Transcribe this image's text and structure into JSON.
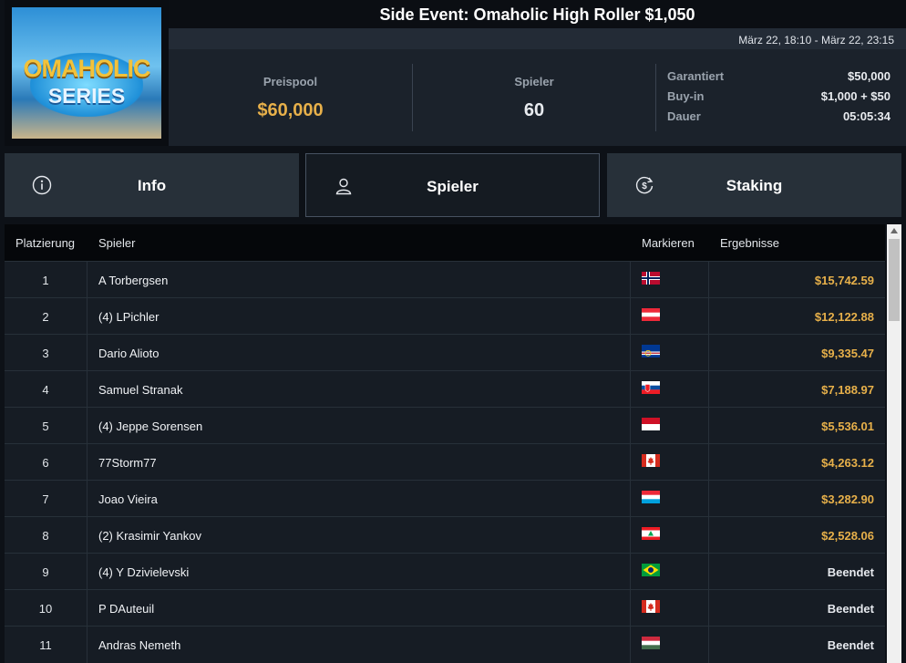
{
  "logo": {
    "line1": "OMAHOLIC",
    "line2": "SERIES"
  },
  "header": {
    "title": "Side Event: Omaholic High Roller $1,050",
    "dates": "März 22, 18:10 - März 22, 23:15"
  },
  "stats": {
    "prizepool_label": "Preispool",
    "prizepool_value": "$60,000",
    "players_label": "Spieler",
    "players_value": "60",
    "details": [
      {
        "key": "Garantiert",
        "value": "$50,000"
      },
      {
        "key": "Buy-in",
        "value": "$1,000 + $50"
      },
      {
        "key": "Dauer",
        "value": "05:05:34"
      }
    ]
  },
  "tabs": [
    {
      "label": "Info",
      "icon": "info-icon"
    },
    {
      "label": "Spieler",
      "icon": "user-icon"
    },
    {
      "label": "Staking",
      "icon": "dollar-refresh-icon"
    }
  ],
  "table": {
    "headers": {
      "rank": "Platzierung",
      "player": "Spieler",
      "flag": "Markieren",
      "result": "Ergebnisse"
    },
    "rows": [
      {
        "rank": "1",
        "player": "A Torbergsen",
        "flag": "norway",
        "result": "$15,742.59"
      },
      {
        "rank": "2",
        "player": "(4) LPichler",
        "flag": "austria",
        "result": "$12,122.88"
      },
      {
        "rank": "3",
        "player": "Dario Alioto",
        "flag": "cape-verde",
        "result": "$9,335.47"
      },
      {
        "rank": "4",
        "player": "Samuel Stranak",
        "flag": "slovakia",
        "result": "$7,188.97"
      },
      {
        "rank": "5",
        "player": "(4) Jeppe Sorensen",
        "flag": "monaco",
        "result": "$5,536.01"
      },
      {
        "rank": "6",
        "player": "77Storm77",
        "flag": "canada",
        "result": "$4,263.12"
      },
      {
        "rank": "7",
        "player": "Joao Vieira",
        "flag": "luxembourg",
        "result": "$3,282.90"
      },
      {
        "rank": "8",
        "player": "(2) Krasimir Yankov",
        "flag": "lebanon",
        "result": "$2,528.06"
      },
      {
        "rank": "9",
        "player": "(4) Y Dzivielevski",
        "flag": "brazil",
        "result": "Beendet"
      },
      {
        "rank": "10",
        "player": "P DAuteuil",
        "flag": "canada",
        "result": "Beendet"
      },
      {
        "rank": "11",
        "player": "Andras Nemeth",
        "flag": "hungary",
        "result": "Beendet"
      }
    ]
  },
  "colors": {
    "gold": "#e7b04a",
    "text": "#e6e9ee",
    "muted": "#9aa3ad"
  }
}
